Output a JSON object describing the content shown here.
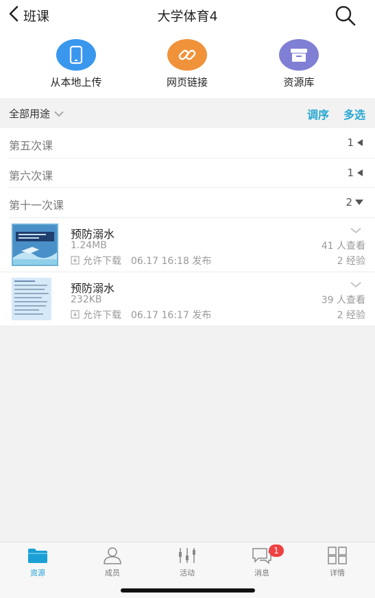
{
  "header": {
    "back_label": "班课",
    "title": "大学体育4"
  },
  "actions": [
    {
      "label": "从本地上传",
      "icon": "phone-upload-icon",
      "color": "#3a97ee"
    },
    {
      "label": "网页链接",
      "icon": "link-icon",
      "color": "#f0923a"
    },
    {
      "label": "资源库",
      "icon": "archive-icon",
      "color": "#7f7fd5"
    }
  ],
  "filter": {
    "label": "全部用途",
    "sort": "调序",
    "multi": "多选"
  },
  "folders": [
    {
      "name": "第五次课",
      "count": "1",
      "state": "collapsed"
    },
    {
      "name": "第六次课",
      "count": "1",
      "state": "collapsed"
    },
    {
      "name": "第十一次课",
      "count": "2",
      "state": "expanded"
    }
  ],
  "files": [
    {
      "name": "预防溺水",
      "size": "1.24MB",
      "download": "允许下载",
      "time": "06.17 16:18 发布",
      "views": "41 人查看",
      "exp": "2 经验"
    },
    {
      "name": "预防溺水",
      "size": "232KB",
      "download": "允许下载",
      "time": "06.17 16:17 发布",
      "views": "39 人查看",
      "exp": "2 经验"
    }
  ],
  "tabs": [
    {
      "label": "资源",
      "icon": "folder-icon",
      "active": true
    },
    {
      "label": "成员",
      "icon": "person-icon",
      "active": false
    },
    {
      "label": "活动",
      "icon": "activity-icon",
      "active": false
    },
    {
      "label": "消息",
      "icon": "message-icon",
      "active": false,
      "badge": "1"
    },
    {
      "label": "详情",
      "icon": "grid-icon",
      "active": false
    }
  ],
  "colors": {
    "accent": "#27a8d2",
    "tab_active": "#1aa0d5",
    "badge": "#f04142"
  }
}
